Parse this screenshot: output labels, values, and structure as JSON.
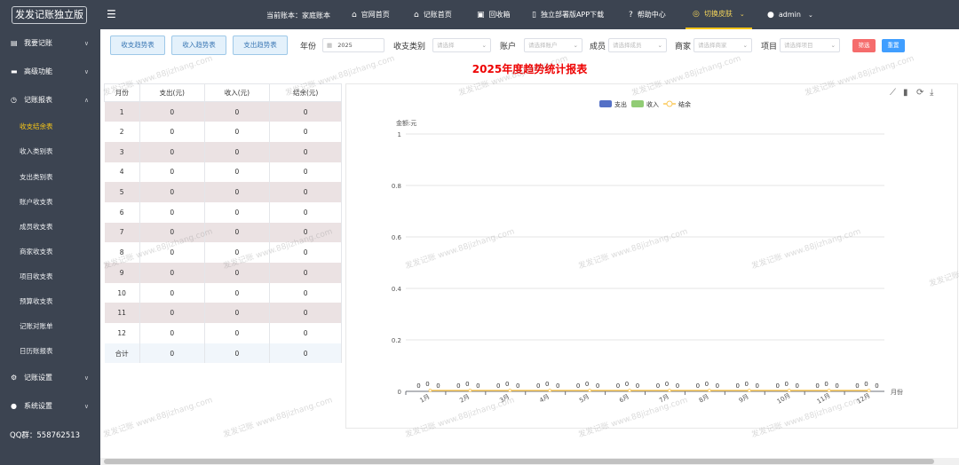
{
  "header": {
    "logo": "发发记账独立版",
    "current_account": "当前账本：家庭账本",
    "nav": [
      {
        "label": "官网首页",
        "icon": "home-icon"
      },
      {
        "label": "记账首页",
        "icon": "home-icon"
      },
      {
        "label": "回收箱",
        "icon": "trash-icon"
      },
      {
        "label": "独立部署版APP下载",
        "icon": "phone-icon"
      },
      {
        "label": "帮助中心",
        "icon": "help-icon"
      },
      {
        "label": "切换皮肤",
        "icon": "palette-icon"
      },
      {
        "label": "admin",
        "icon": "user-icon"
      }
    ]
  },
  "sidebar": {
    "groups": [
      {
        "label": "我要记账",
        "icon": "book-icon"
      },
      {
        "label": "高级功能",
        "icon": "briefcase-icon"
      },
      {
        "label": "记账报表",
        "icon": "clock-icon"
      },
      {
        "label": "记账设置",
        "icon": "gear-icon"
      },
      {
        "label": "系统设置",
        "icon": "user-icon"
      }
    ],
    "sub_items": [
      "收支结余表",
      "收入类别表",
      "支出类别表",
      "账户收支表",
      "成员收支表",
      "商家收支表",
      "项目收支表",
      "预算收支表",
      "记账对账单",
      "日历账报表"
    ],
    "qq": "QQ群：558762513"
  },
  "toolbar": {
    "trend_buttons": [
      "收支趋势表",
      "收入趋势表",
      "支出趋势表"
    ],
    "year_label": "年份",
    "year_value": "2025",
    "type_label": "收支类别",
    "type_placeholder": "请选择",
    "account_label": "账户",
    "account_placeholder": "请选择账户",
    "member_label": "成员",
    "member_placeholder": "请选择成员",
    "merchant_label": "商家",
    "merchant_placeholder": "请选择商家",
    "project_label": "项目",
    "project_placeholder": "请选择项目",
    "filter_label": "筛选",
    "reset_label": "重置"
  },
  "report_title": "2025年度趋势统计报表",
  "table": {
    "headers": [
      "月份",
      "支出(元)",
      "收入(元)",
      "结余(元)"
    ],
    "rows": [
      [
        "1",
        "0",
        "0",
        "0"
      ],
      [
        "2",
        "0",
        "0",
        "0"
      ],
      [
        "3",
        "0",
        "0",
        "0"
      ],
      [
        "4",
        "0",
        "0",
        "0"
      ],
      [
        "5",
        "0",
        "0",
        "0"
      ],
      [
        "6",
        "0",
        "0",
        "0"
      ],
      [
        "7",
        "0",
        "0",
        "0"
      ],
      [
        "8",
        "0",
        "0",
        "0"
      ],
      [
        "9",
        "0",
        "0",
        "0"
      ],
      [
        "10",
        "0",
        "0",
        "0"
      ],
      [
        "11",
        "0",
        "0",
        "0"
      ],
      [
        "12",
        "0",
        "0",
        "0"
      ],
      [
        "合计",
        "0",
        "0",
        "0"
      ]
    ]
  },
  "watermark": "发发记账 www.88jizhang.com",
  "colors": {
    "expense": "#5470c6",
    "income": "#91cc75",
    "balance": "#fac858",
    "title": "#ee0000",
    "sidebar": "#3c4451"
  },
  "chart_data": {
    "type": "bar",
    "ylabel": "金额:元",
    "xlabel": "月份",
    "ylim": [
      0,
      1
    ],
    "yticks": [
      "0",
      "0.2",
      "0.4",
      "0.6",
      "0.8",
      "1"
    ],
    "categories": [
      "1月",
      "2月",
      "3月",
      "4月",
      "5月",
      "6月",
      "7月",
      "8月",
      "9月",
      "10月",
      "11月",
      "12月"
    ],
    "series": [
      {
        "name": "支出",
        "type": "bar",
        "values": [
          0,
          0,
          0,
          0,
          0,
          0,
          0,
          0,
          0,
          0,
          0,
          0
        ]
      },
      {
        "name": "收入",
        "type": "bar",
        "values": [
          0,
          0,
          0,
          0,
          0,
          0,
          0,
          0,
          0,
          0,
          0,
          0
        ]
      },
      {
        "name": "结余",
        "type": "line",
        "values": [
          0,
          0,
          0,
          0,
          0,
          0,
          0,
          0,
          0,
          0,
          0,
          0
        ]
      }
    ],
    "legend_position": "top",
    "toolbox_icons": [
      "line-chart-icon",
      "bar-chart-icon",
      "restore-icon",
      "download-icon"
    ]
  }
}
